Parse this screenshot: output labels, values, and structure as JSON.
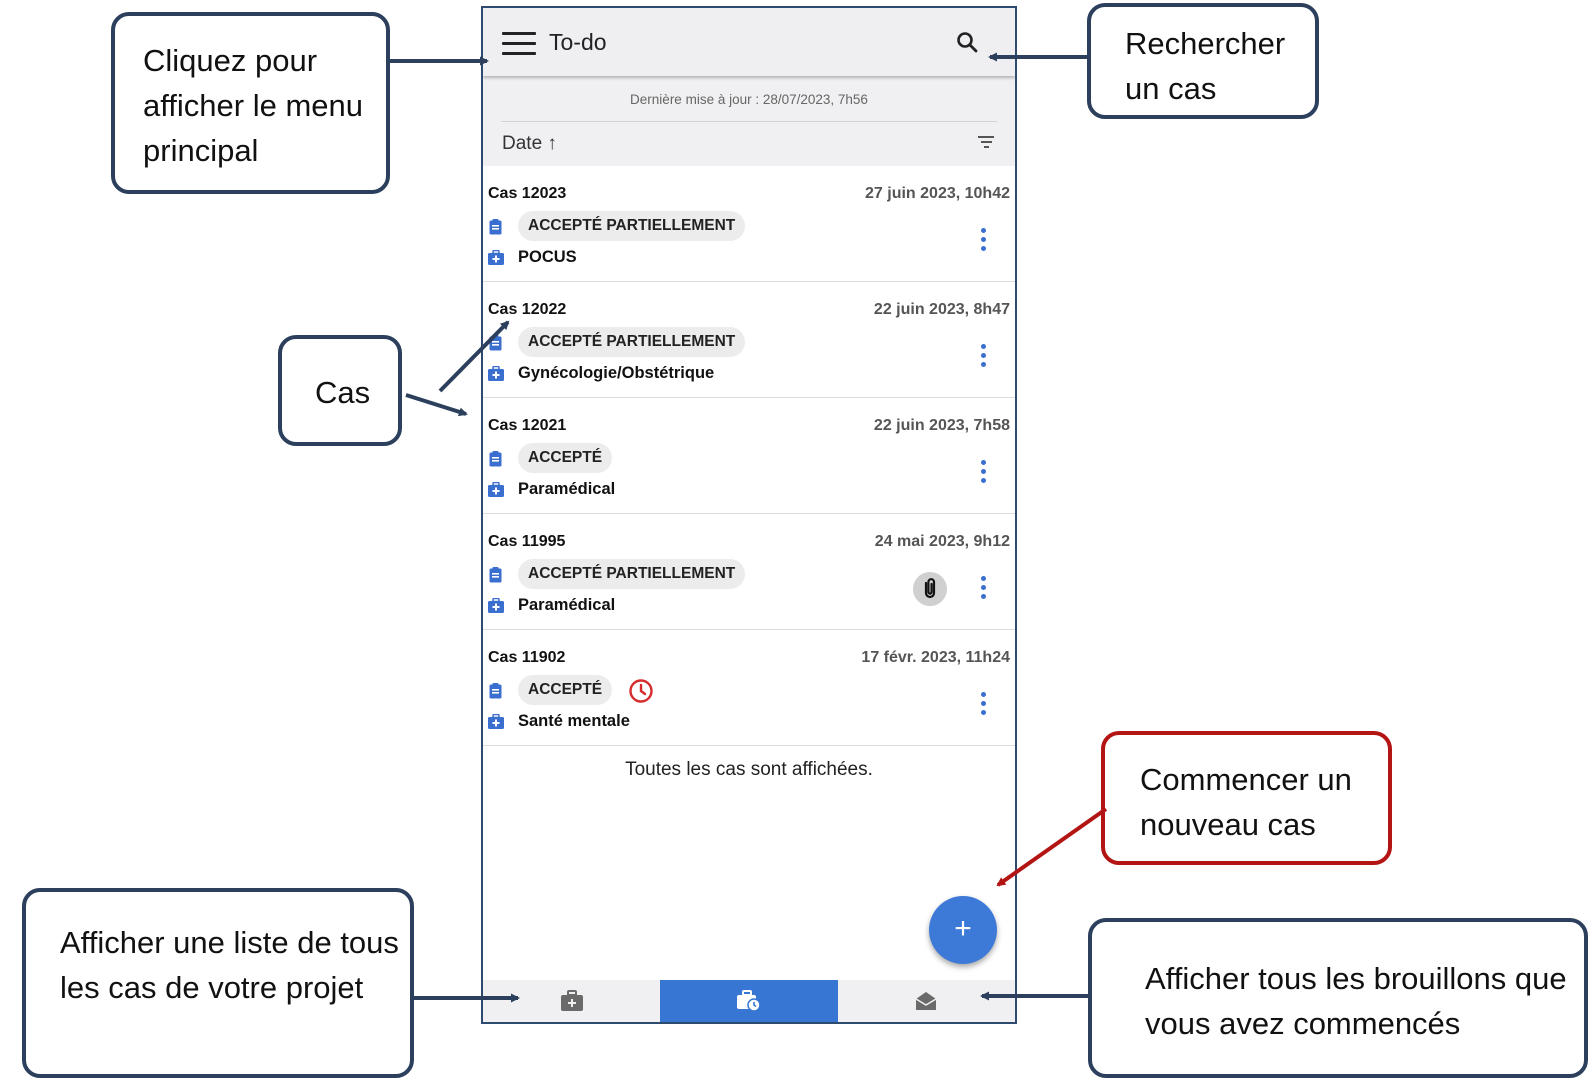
{
  "app": {
    "title": "To-do",
    "last_update": "Dernière mise à jour : 28/07/2023, 7h56",
    "sort_label": "Date ↑",
    "end_message": "Toutes les cas sont affichées.",
    "fab_label": "+"
  },
  "cases": [
    {
      "title": "Cas 12023",
      "date": "27 juin 2023, 10h42",
      "status": "ACCEPTÉ PARTIELLEMENT",
      "type": "POCUS",
      "has_attachment": false,
      "overdue": false
    },
    {
      "title": "Cas 12022",
      "date": "22 juin 2023, 8h47",
      "status": "ACCEPTÉ PARTIELLEMENT",
      "type": "Gynécologie/Obstétrique",
      "has_attachment": false,
      "overdue": false
    },
    {
      "title": "Cas 12021",
      "date": "22 juin 2023, 7h58",
      "status": "ACCEPTÉ",
      "type": "Paramédical",
      "has_attachment": false,
      "overdue": false
    },
    {
      "title": "Cas 11995",
      "date": "24 mai 2023, 9h12",
      "status": "ACCEPTÉ PARTIELLEMENT",
      "type": "Paramédical",
      "has_attachment": true,
      "overdue": false
    },
    {
      "title": "Cas 11902",
      "date": "17 févr. 2023, 11h24",
      "status": "ACCEPTÉ",
      "type": "Santé mentale",
      "has_attachment": false,
      "overdue": true
    }
  ],
  "bottom_nav": [
    {
      "label": "Cas",
      "icon": "briefcase-plus-icon",
      "active": false
    },
    {
      "label": "To-do",
      "icon": "briefcase-clock-icon",
      "active": true
    },
    {
      "label": "Brouillons",
      "icon": "open-envelope-icon",
      "active": false
    }
  ],
  "annotations": {
    "menu": "Cliquez pour afficher le menu principal",
    "search": "Rechercher un cas",
    "cases": "Cas",
    "new_case": "Commencer un nouveau cas",
    "all_cases": "Afficher une liste de tous les cas de votre projet",
    "drafts": "Afficher tous les brouillons que vous avez commencés"
  },
  "colors": {
    "accent": "#3777d3",
    "annotation_border": "#2c3f5d",
    "annotation_border_highlight": "#b31414",
    "overdue": "#d62b2b"
  }
}
